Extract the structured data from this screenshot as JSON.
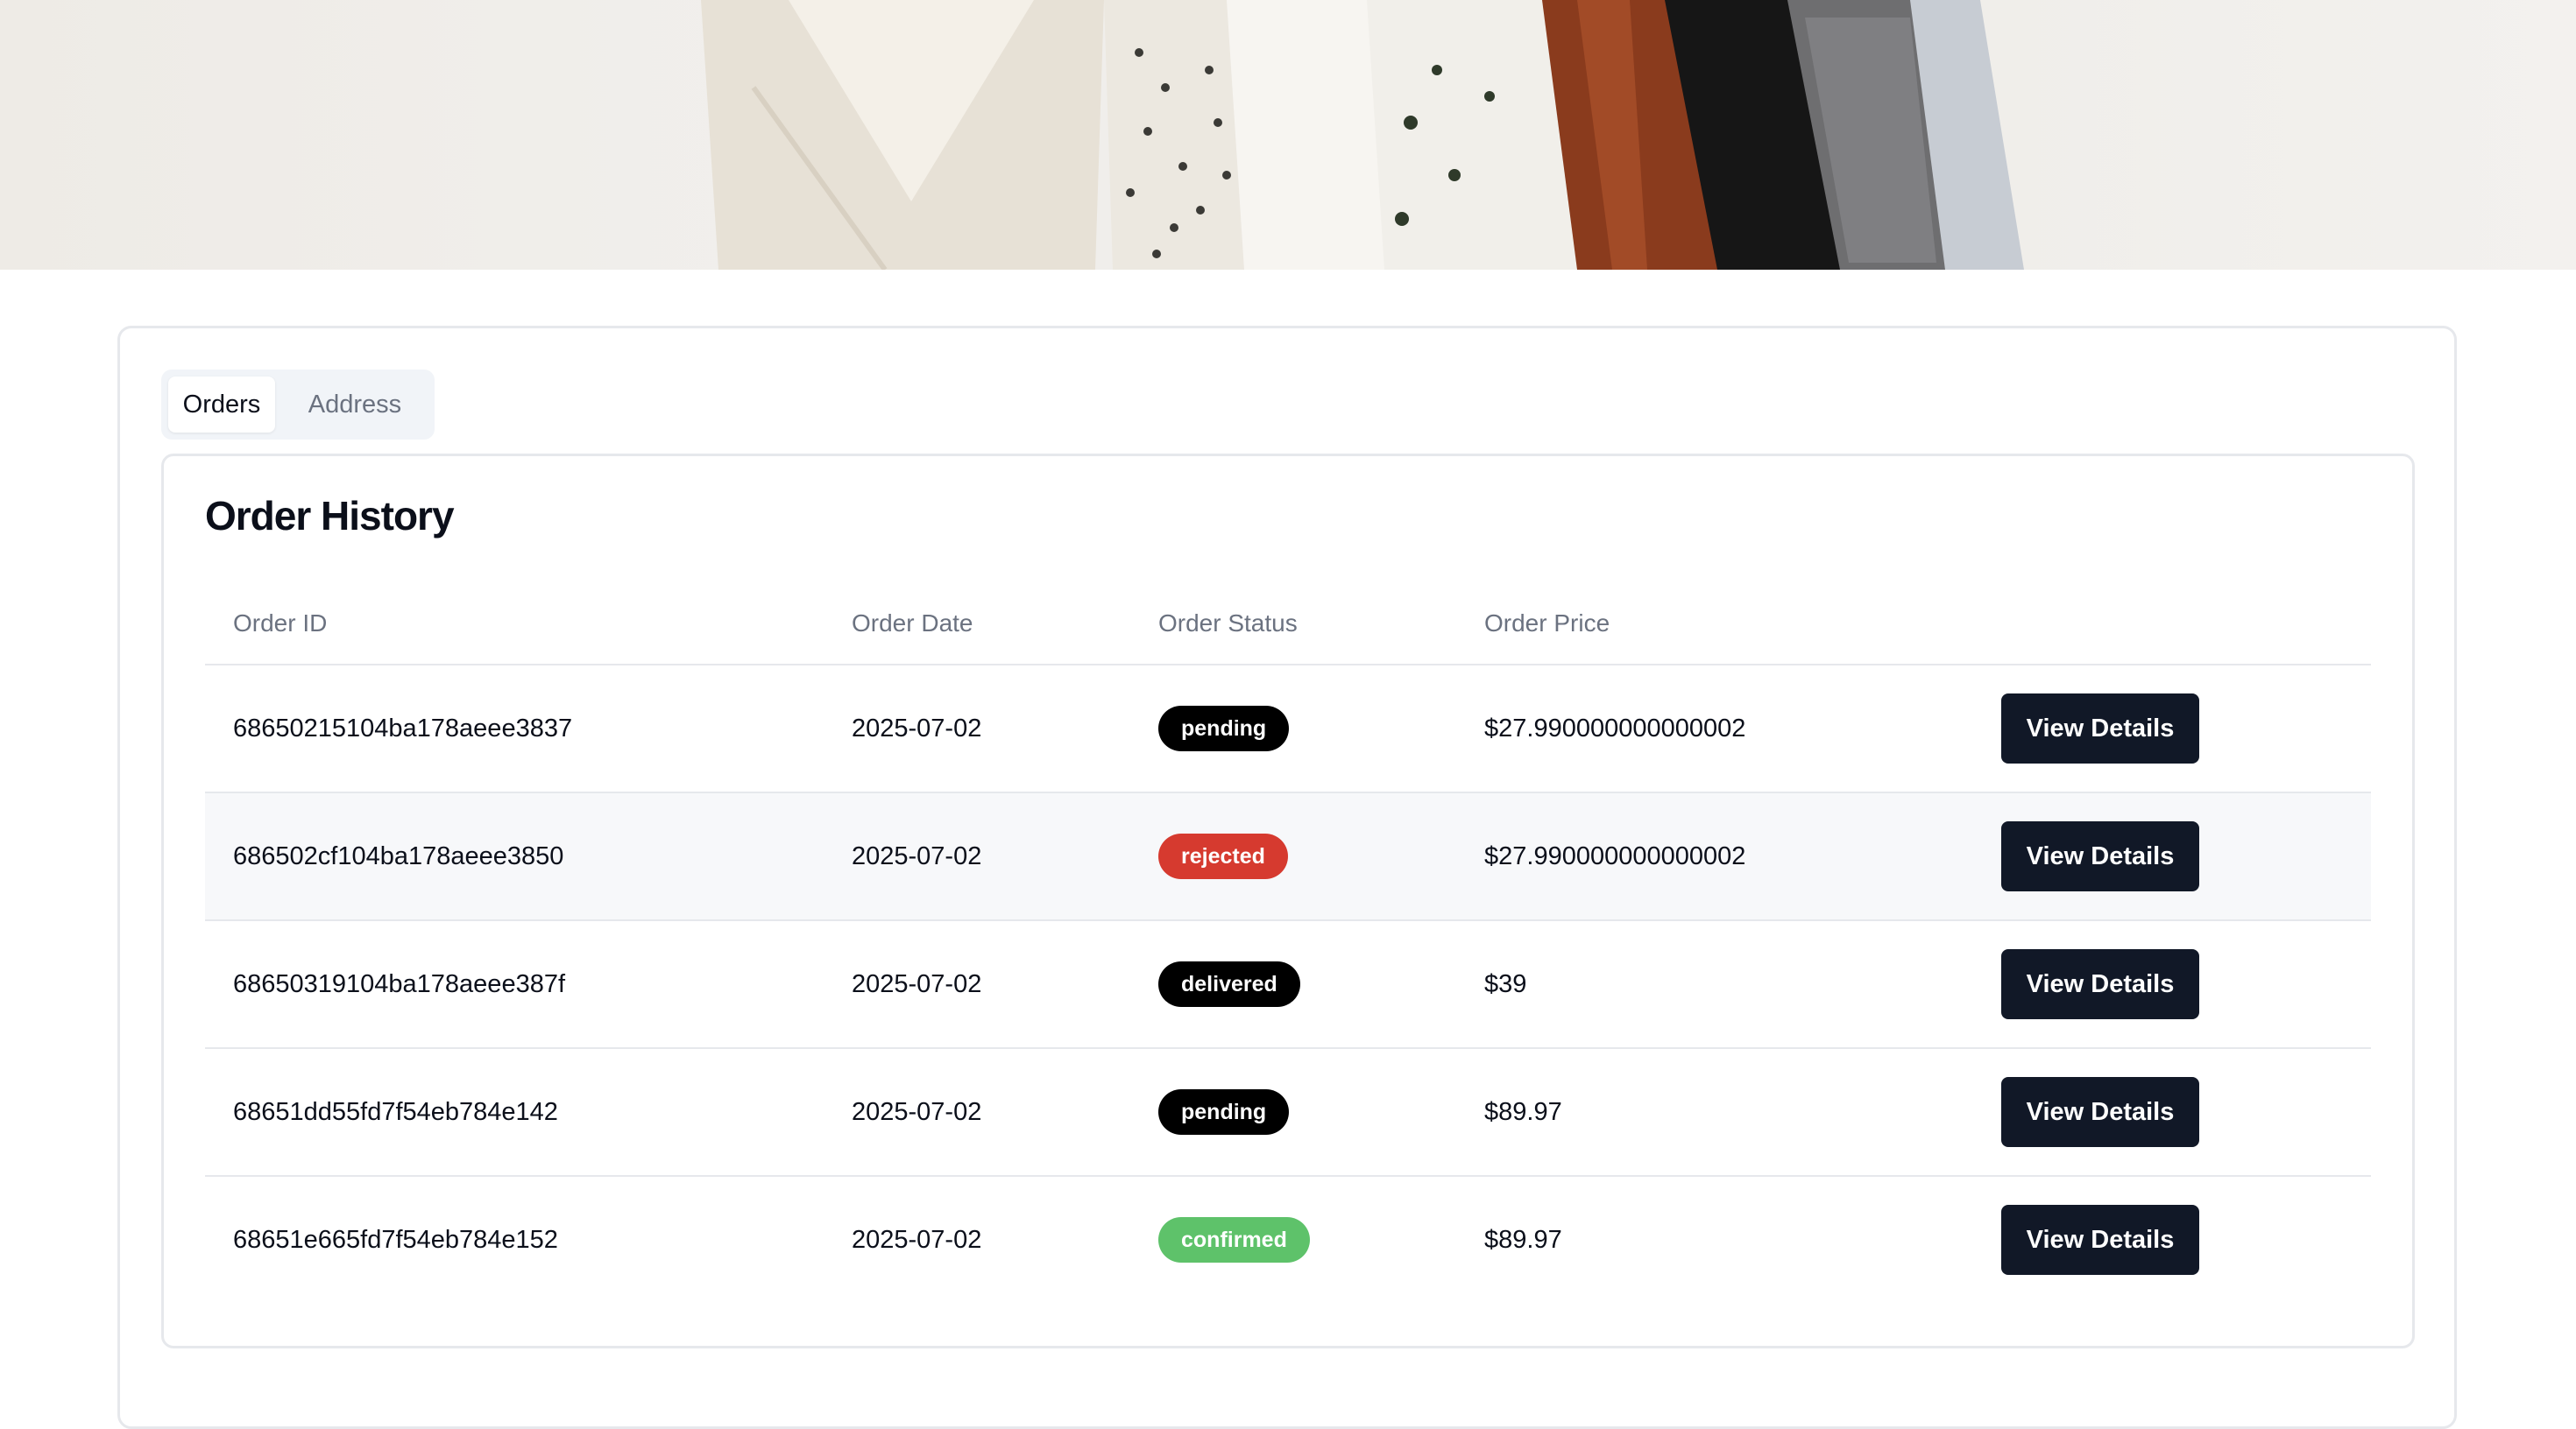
{
  "tabs": [
    {
      "label": "Orders",
      "active": true
    },
    {
      "label": "Address",
      "active": false
    }
  ],
  "section_title": "Order History",
  "table": {
    "headers": [
      "Order ID",
      "Order Date",
      "Order Status",
      "Order Price",
      ""
    ],
    "rows": [
      {
        "id": "68650215104ba178aeee3837",
        "date": "2025-07-02",
        "status": "pending",
        "price": "$27.990000000000002",
        "action": "View Details"
      },
      {
        "id": "686502cf104ba178aeee3850",
        "date": "2025-07-02",
        "status": "rejected",
        "price": "$27.990000000000002",
        "action": "View Details"
      },
      {
        "id": "68650319104ba178aeee387f",
        "date": "2025-07-02",
        "status": "delivered",
        "price": "$39",
        "action": "View Details"
      },
      {
        "id": "68651dd55fd7f54eb784e142",
        "date": "2025-07-02",
        "status": "pending",
        "price": "$89.97",
        "action": "View Details"
      },
      {
        "id": "68651e665fd7f54eb784e152",
        "date": "2025-07-02",
        "status": "confirmed",
        "price": "$89.97",
        "action": "View Details"
      }
    ]
  },
  "colors": {
    "pending": "#000000",
    "rejected": "#d63a2f",
    "delivered": "#000000",
    "confirmed": "#5ec26a",
    "button": "#111827"
  }
}
